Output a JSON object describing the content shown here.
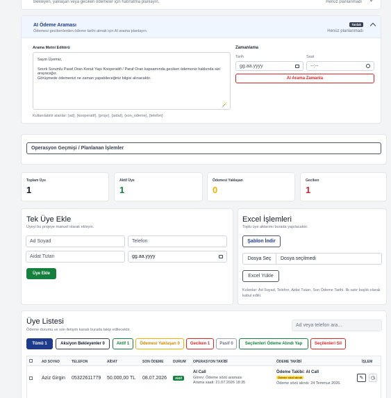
{
  "top_card": {
    "subtitle": "Bekleyen, yaklaşan veya geciken ödemeler için hatırlatma planlayın.",
    "status": "Henüz planlanmadı"
  },
  "ai_card": {
    "title": "AI Ödeme Araması",
    "subtitle": "Ödemesi gecikenlerden ödeme tarihi almak için AI arama planlayın.",
    "badge": "Taslak",
    "status": "Henüz planlanmadı",
    "editor_label": "Arama Metni Editörü",
    "script_text": "Sayın Üyemiz,\n\nSınırlı Sorumlu Paraf Oran Konut Yapı Kooperatifi / Paraf Oran kapsamında geciken ödemeniz hakkında sizi arayacağız.\nGörüşmede ödemenizi ne zaman yapabileceğiniz bilgisi alınacaktır.",
    "vars_hint": "Kullanılabilir alanlar: {ad}, {kooperatif}, {proje}, {aidat}, {son_odeme}, {telefon}",
    "schedule_label": "Zamanlama",
    "date_label": "Tarih",
    "date_value": "gg.aa.yyyy",
    "time_label": "Saat",
    "time_value": "--:--",
    "schedule_button": "AI Arama Zamanla"
  },
  "history": {
    "button": "Operasyon Geçmişi / Planlanan İşlemler"
  },
  "stats": [
    {
      "label": "Toplam Üye",
      "value": "1",
      "color": "#111827"
    },
    {
      "label": "Aktif Üye",
      "value": "1",
      "color": "#15803d"
    },
    {
      "label": "Ödemesi Yaklaşan",
      "value": "0",
      "color": "#eab308"
    },
    {
      "label": "Geciken",
      "value": "1",
      "color": "#dc2626"
    }
  ],
  "add_member": {
    "title": "Tek Üye Ekle",
    "subtitle": "Üyeyi bu projeye manuel olarak ekleyin.",
    "name_placeholder": "Ad Soyad",
    "phone_placeholder": "Telefon",
    "fee_placeholder": "Aidat Tutarı",
    "date_value": "gg.aa.yyyy",
    "submit": "Üye Ekle"
  },
  "excel": {
    "title": "Excel İşlemleri",
    "subtitle": "Toplu üye aktarımı burada yapılacaktır.",
    "template_button": "Şablon İndir",
    "file_button": "Dosya Seç",
    "file_status": "Dosya seçilmedi",
    "upload_button": "Excel Yükle",
    "hint": "Kolonlar: Ad Soyad, Telefon, Aidat Tutarı, Son Ödeme Tarihi. İlk satır başlık olarak kabul edilir."
  },
  "member_list": {
    "title": "Üye Listesi",
    "subtitle": "Ödeme durumu ve son iletişim kanalı burada takip edilecektir.",
    "search_placeholder": "Ad veya telefon ara...",
    "filters": [
      {
        "label": "Tümü 1"
      },
      {
        "label": "Aksiyon Bekleyenler 0"
      },
      {
        "label": "Aktif 1"
      },
      {
        "label": "Ödemesi Yaklaşan 0"
      },
      {
        "label": "Geciken 1"
      },
      {
        "label": "Pasif 0"
      },
      {
        "label": "Seçilenleri Ödeme Alındı Yap"
      },
      {
        "label": "Seçilenleri Sil"
      }
    ],
    "columns": [
      "AD SOYAD",
      "TELEFON",
      "AİDAT",
      "SON ÖDEME",
      "DURUM",
      "OPERASYON TAKİBİ",
      "ÖDEME TAKİBİ",
      "İŞLEM"
    ],
    "rows": [
      {
        "name": "Aziz Girgin",
        "phone": "05322611779",
        "fee": "50.000,00 TL",
        "due": "08.07.2026",
        "status": "Aktif",
        "op_title": "AI Call",
        "op_task": "Görev: Ödeme sözü araması",
        "op_time": "Arama saati: 21.07.2026 18:35",
        "pay_title": "Ödeme Takibi: AI Call",
        "pay_badge": "Ödeme sözü alındı",
        "pay_note": "Ödeme sözü alındı: 24 Temmuz 2026."
      }
    ]
  },
  "colors": {
    "primary": "#1e3a8a",
    "green": "#15803d",
    "yellow": "#eab308",
    "red": "#dc2626"
  }
}
